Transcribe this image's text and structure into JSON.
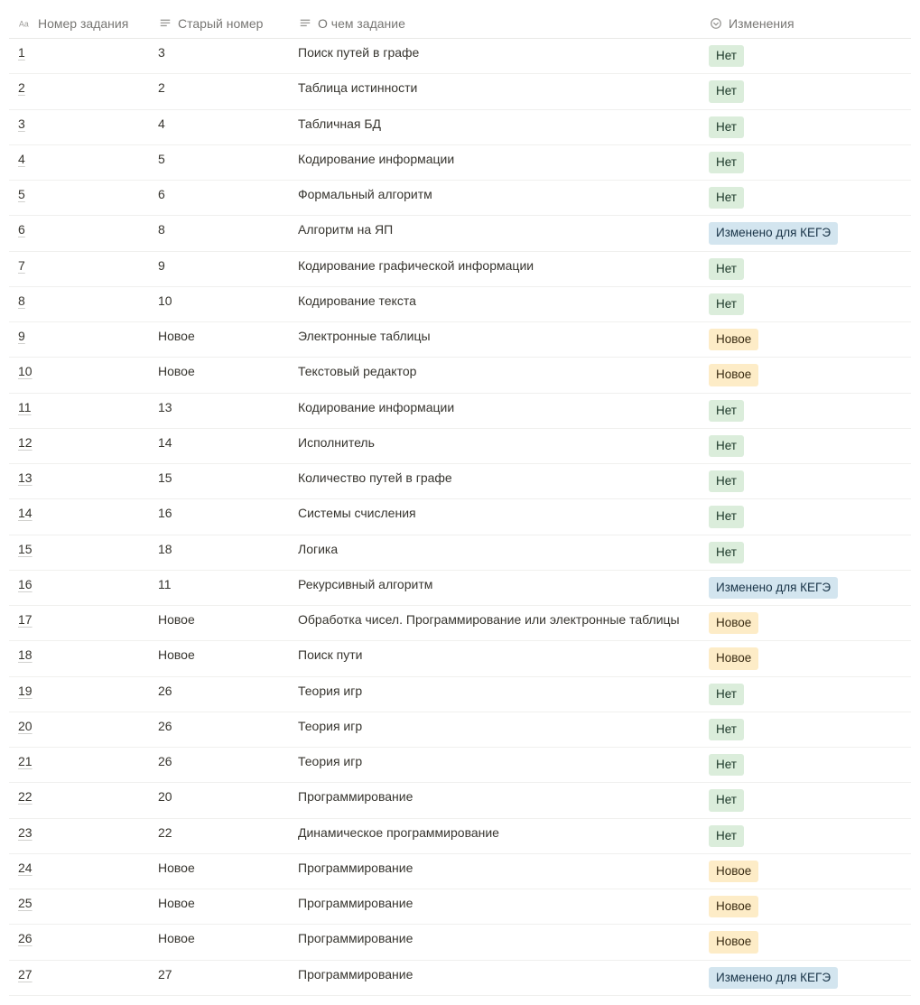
{
  "columns": {
    "number": "Номер задания",
    "old_number": "Старый номер",
    "about": "О чем задание",
    "changes": "Изменения"
  },
  "tags": {
    "no": "Нет",
    "new": "Новое",
    "changed": "Изменено для КЕГЭ"
  },
  "rows": [
    {
      "num": "1",
      "old": "3",
      "about": "Поиск путей в графе",
      "change": "no"
    },
    {
      "num": "2",
      "old": "2",
      "about": "Таблица истинности",
      "change": "no"
    },
    {
      "num": "3",
      "old": "4",
      "about": "Табличная БД",
      "change": "no"
    },
    {
      "num": "4",
      "old": "5",
      "about": "Кодирование информации",
      "change": "no"
    },
    {
      "num": "5",
      "old": "6",
      "about": "Формальный алгоритм",
      "change": "no"
    },
    {
      "num": "6",
      "old": "8",
      "about": "Алгоритм на ЯП",
      "change": "changed"
    },
    {
      "num": "7",
      "old": "9",
      "about": "Кодирование графической информации",
      "change": "no"
    },
    {
      "num": "8",
      "old": "10",
      "about": "Кодирование текста",
      "change": "no"
    },
    {
      "num": "9",
      "old": "Новое",
      "about": "Электронные таблицы",
      "change": "new"
    },
    {
      "num": "10",
      "old": "Новое",
      "about": "Текстовый редактор",
      "change": "new"
    },
    {
      "num": "11",
      "old": "13",
      "about": "Кодирование информации",
      "change": "no"
    },
    {
      "num": "12",
      "old": "14",
      "about": "Исполнитель",
      "change": "no"
    },
    {
      "num": "13",
      "old": "15",
      "about": "Количество путей в графе",
      "change": "no"
    },
    {
      "num": "14",
      "old": "16",
      "about": "Системы счисления",
      "change": "no"
    },
    {
      "num": "15",
      "old": "18",
      "about": "Логика",
      "change": "no"
    },
    {
      "num": "16",
      "old": "11",
      "about": "Рекурсивный алгоритм",
      "change": "changed"
    },
    {
      "num": "17",
      "old": "Новое",
      "about": "Обработка чисел. Программирование или электронные таблицы",
      "change": "new"
    },
    {
      "num": "18",
      "old": "Новое",
      "about": "Поиск пути",
      "change": "new"
    },
    {
      "num": "19",
      "old": "26",
      "about": "Теория игр",
      "change": "no"
    },
    {
      "num": "20",
      "old": "26",
      "about": "Теория игр",
      "change": "no"
    },
    {
      "num": "21",
      "old": "26",
      "about": "Теория игр",
      "change": "no"
    },
    {
      "num": "22",
      "old": "20",
      "about": "Программирование",
      "change": "no"
    },
    {
      "num": "23",
      "old": "22",
      "about": "Динамическое программирование",
      "change": "no"
    },
    {
      "num": "24",
      "old": "Новое",
      "about": "Программирование",
      "change": "new"
    },
    {
      "num": "25",
      "old": "Новое",
      "about": "Программирование",
      "change": "new"
    },
    {
      "num": "26",
      "old": "Новое",
      "about": "Программирование",
      "change": "new"
    },
    {
      "num": "27",
      "old": "27",
      "about": "Программирование",
      "change": "changed"
    }
  ]
}
